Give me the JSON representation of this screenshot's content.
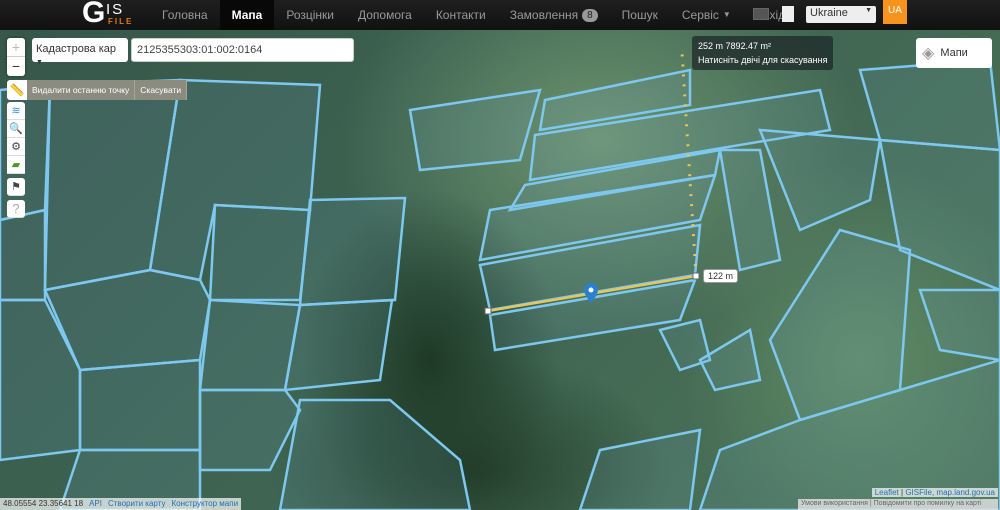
{
  "nav": {
    "logo": "GIS FILE",
    "logo_g": "G",
    "logo_is": "IS",
    "logo_file": "FILE",
    "items": [
      {
        "label": "Головна"
      },
      {
        "label": "Мапа",
        "active": true
      },
      {
        "label": "Розцінки"
      },
      {
        "label": "Допомога"
      },
      {
        "label": "Контакти"
      },
      {
        "label": "Замовлення",
        "badge": "8"
      },
      {
        "label": "Пошук"
      },
      {
        "label": "Сервіс"
      },
      {
        "label": "Вихід"
      }
    ],
    "country": "Ukraine",
    "lang": "UA"
  },
  "map": {
    "zoom_in": "+",
    "zoom_out": "−",
    "layer_select": "Кадастрова кар",
    "search_value": "2125355303:01:002:0164",
    "measure": {
      "delete_last": "Видалити останню точку",
      "cancel": "Скасувати"
    },
    "tooltip": {
      "line1": "252 m 7892.47 m²",
      "line2": "Натисніть двічі для скасування"
    },
    "segment_label": "122 m",
    "layers_button": "Мапи",
    "tools": {
      "help": "?"
    }
  },
  "footer": {
    "coords": "48.05554 23.35641 18",
    "api": "API",
    "create_map": "Створити карту",
    "constructor": "Конструктор мапи",
    "leaflet": "Leaflet",
    "attribution": "GISFile, map.land.gov.ua",
    "terms": "Умови використання",
    "report": "Повідомити про помилку на карті"
  },
  "colors": {
    "accent": "#f7941d",
    "parcel": "#7ec8f0",
    "measure_line": "#e8c55a"
  }
}
